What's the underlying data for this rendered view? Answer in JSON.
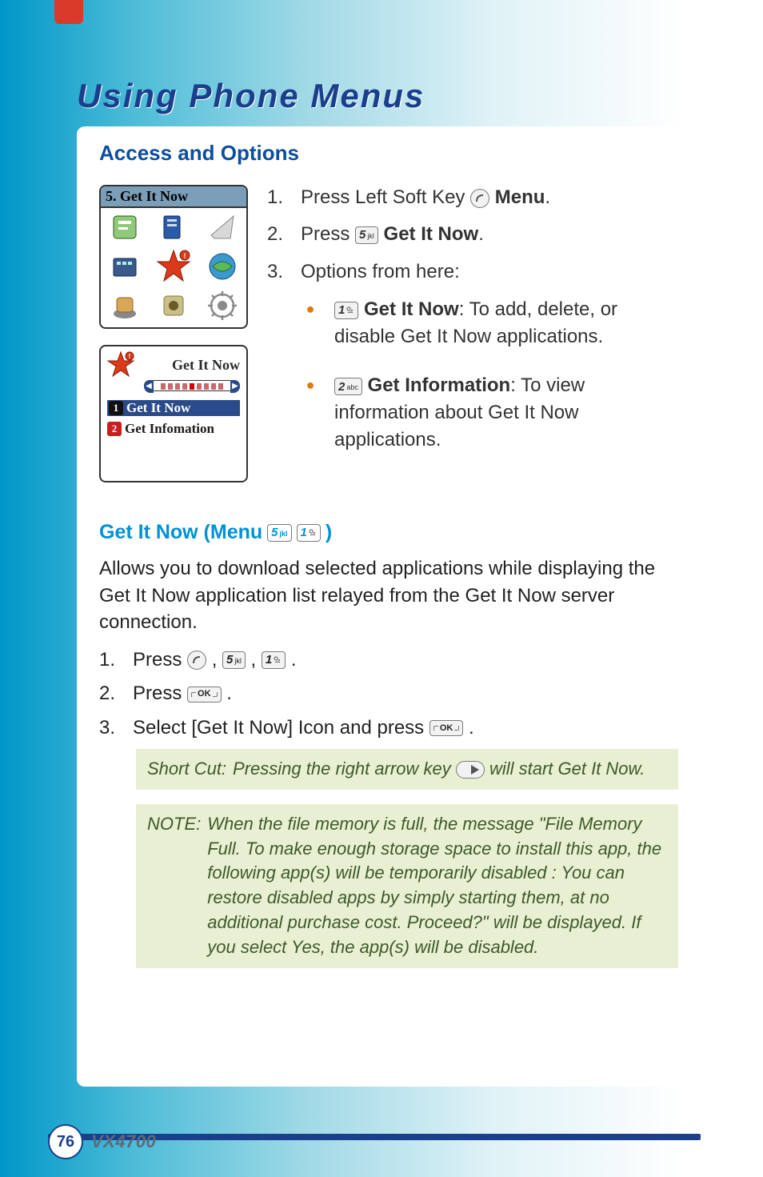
{
  "page": {
    "chapter_title": "Using Phone Menus",
    "number": "76",
    "model": "VX4700"
  },
  "section": {
    "heading": "Access and Options"
  },
  "screen1": {
    "title": "5. Get It Now"
  },
  "screen2": {
    "title": "Get It Now",
    "item1_num": "1",
    "item1_label": "Get It Now",
    "item2_num": "2",
    "item2_label": "Get Infomation"
  },
  "steps": {
    "s1_num": "1.",
    "s1_a": "Press Left Soft Key ",
    "s1_b": "Menu",
    "s1_c": ".",
    "s2_num": "2.",
    "s2_a": "Press ",
    "s2_b": "Get It Now",
    "s2_c": ".",
    "s3_num": "3.",
    "s3_a": "Options from here:",
    "b1_a": "Get It Now",
    "b1_b": ": To add, delete, or disable Get It Now applications.",
    "b2_a": "Get Information",
    "b2_b": ": To view information about Get It Now applications."
  },
  "keys": {
    "k5_digit": "5",
    "k5_letters": "jkl",
    "k1_digit": "1",
    "k1_letters": "",
    "k2_digit": "2",
    "k2_letters": "abc",
    "ok": "OK"
  },
  "sub": {
    "title_a": "Get It Now (Menu ",
    "title_b": ")",
    "para": "Allows you to download selected applications while displaying the Get It Now application list relayed from the Get It Now server connection.",
    "n1_num": "1.",
    "n1_a": "Press ",
    "n1_comma": " , ",
    "n1_comma2": ", ",
    "n1_end": ".",
    "n2_num": "2.",
    "n2_a": "Press ",
    "n2_end": ".",
    "n3_num": "3.",
    "n3_a": "Select [Get It Now] Icon and press ",
    "n3_end": "."
  },
  "callouts": {
    "shortcut_label": "Short Cut:",
    "shortcut_a": "Pressing the right arrow key ",
    "shortcut_b": " will start Get It Now.",
    "note_label": "NOTE:",
    "note_text": "When the file memory is full, the message \"File Memory Full. To make enough storage space to install this app, the following app(s) will be temporarily disabled :  You can restore disabled apps by simply starting them, at no additional purchase cost. Proceed?\" will be displayed. If you select Yes, the app(s) will be disabled."
  }
}
